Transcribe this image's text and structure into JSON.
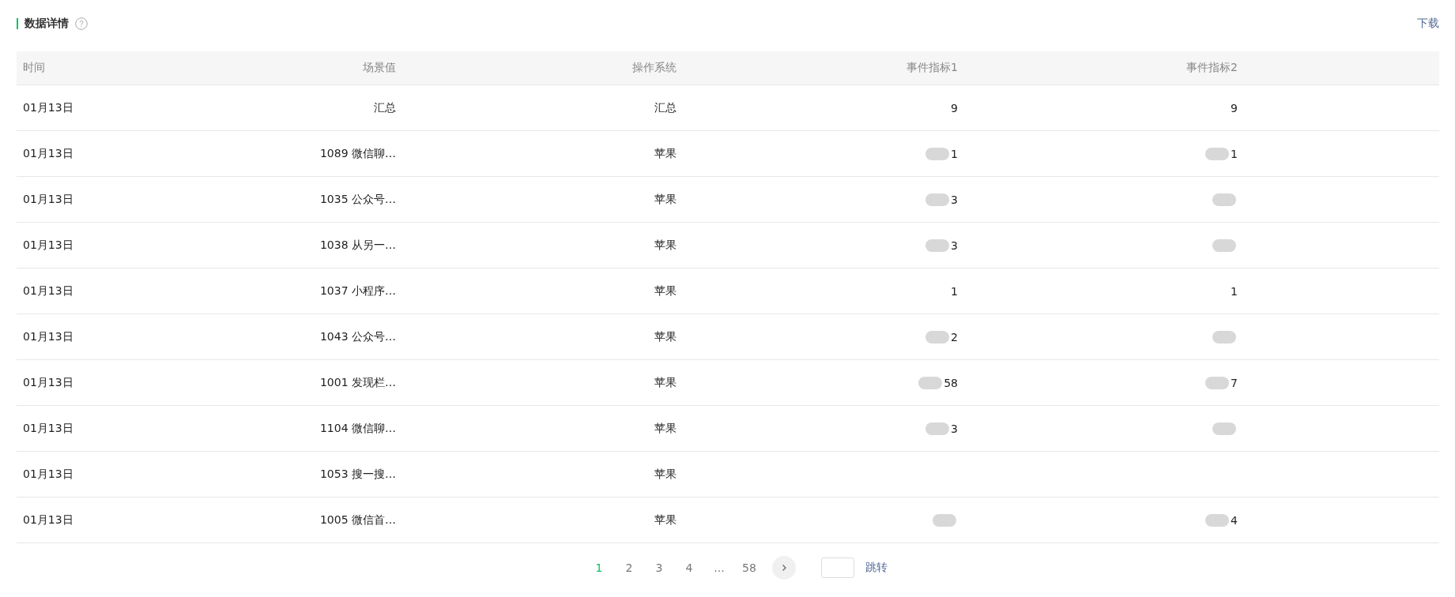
{
  "section": {
    "title": "数据详情",
    "action": "下载"
  },
  "table": {
    "columns": [
      "时间",
      "场景值",
      "操作系统",
      "事件指标1",
      "事件指标2"
    ],
    "rows": [
      {
        "time": "01月13日",
        "scene": "汇总",
        "os": "汇总",
        "metric_1": {
          "text": "9",
          "redacted": false
        },
        "metric_2": {
          "text": "9",
          "redacted": false
        }
      },
      {
        "time": "01月13日",
        "scene": "1089 微信聊…",
        "os": "苹果",
        "metric_1": {
          "text": "1",
          "redacted": true
        },
        "metric_2": {
          "text": "1",
          "redacted": true
        }
      },
      {
        "time": "01月13日",
        "scene": "1035 公众号…",
        "os": "苹果",
        "metric_1": {
          "text": "3",
          "redacted": true
        },
        "metric_2": {
          "redacted": true
        }
      },
      {
        "time": "01月13日",
        "scene": "1038 从另一…",
        "os": "苹果",
        "metric_1": {
          "text": "3",
          "redacted": true
        },
        "metric_2": {
          "redacted": true
        }
      },
      {
        "time": "01月13日",
        "scene": "1037 小程序…",
        "os": "苹果",
        "metric_1": {
          "text": "1",
          "redacted": false
        },
        "metric_2": {
          "text": "1",
          "redacted": false
        }
      },
      {
        "time": "01月13日",
        "scene": "1043 公众号…",
        "os": "苹果",
        "metric_1": {
          "text": "2",
          "redacted": true
        },
        "metric_2": {
          "redacted": true
        }
      },
      {
        "time": "01月13日",
        "scene": "1001 发现栏…",
        "os": "苹果",
        "metric_1": {
          "text": "58",
          "redacted": true
        },
        "metric_2": {
          "text": "7",
          "redacted": true
        }
      },
      {
        "time": "01月13日",
        "scene": "1104 微信聊…",
        "os": "苹果",
        "metric_1": {
          "text": "3",
          "redacted": true
        },
        "metric_2": {
          "redacted": true
        }
      },
      {
        "time": "01月13日",
        "scene": "1053 搜一搜…",
        "os": "苹果",
        "metric_1": {
          "redacted": false
        },
        "metric_2": {
          "redacted": false
        }
      },
      {
        "time": "01月13日",
        "scene": "1005 微信首…",
        "os": "苹果",
        "metric_1": {
          "redacted": true
        },
        "metric_2": {
          "text": "4",
          "redacted": true
        }
      }
    ]
  },
  "pagination": {
    "pages": [
      {
        "label": "1",
        "selected": true
      },
      {
        "label": "2",
        "selected": false
      },
      {
        "label": "3",
        "selected": false
      },
      {
        "label": "4",
        "selected": false
      },
      {
        "label": "...",
        "selected": false
      },
      {
        "label": "58",
        "selected": false
      }
    ],
    "jump_label": "跳转"
  }
}
